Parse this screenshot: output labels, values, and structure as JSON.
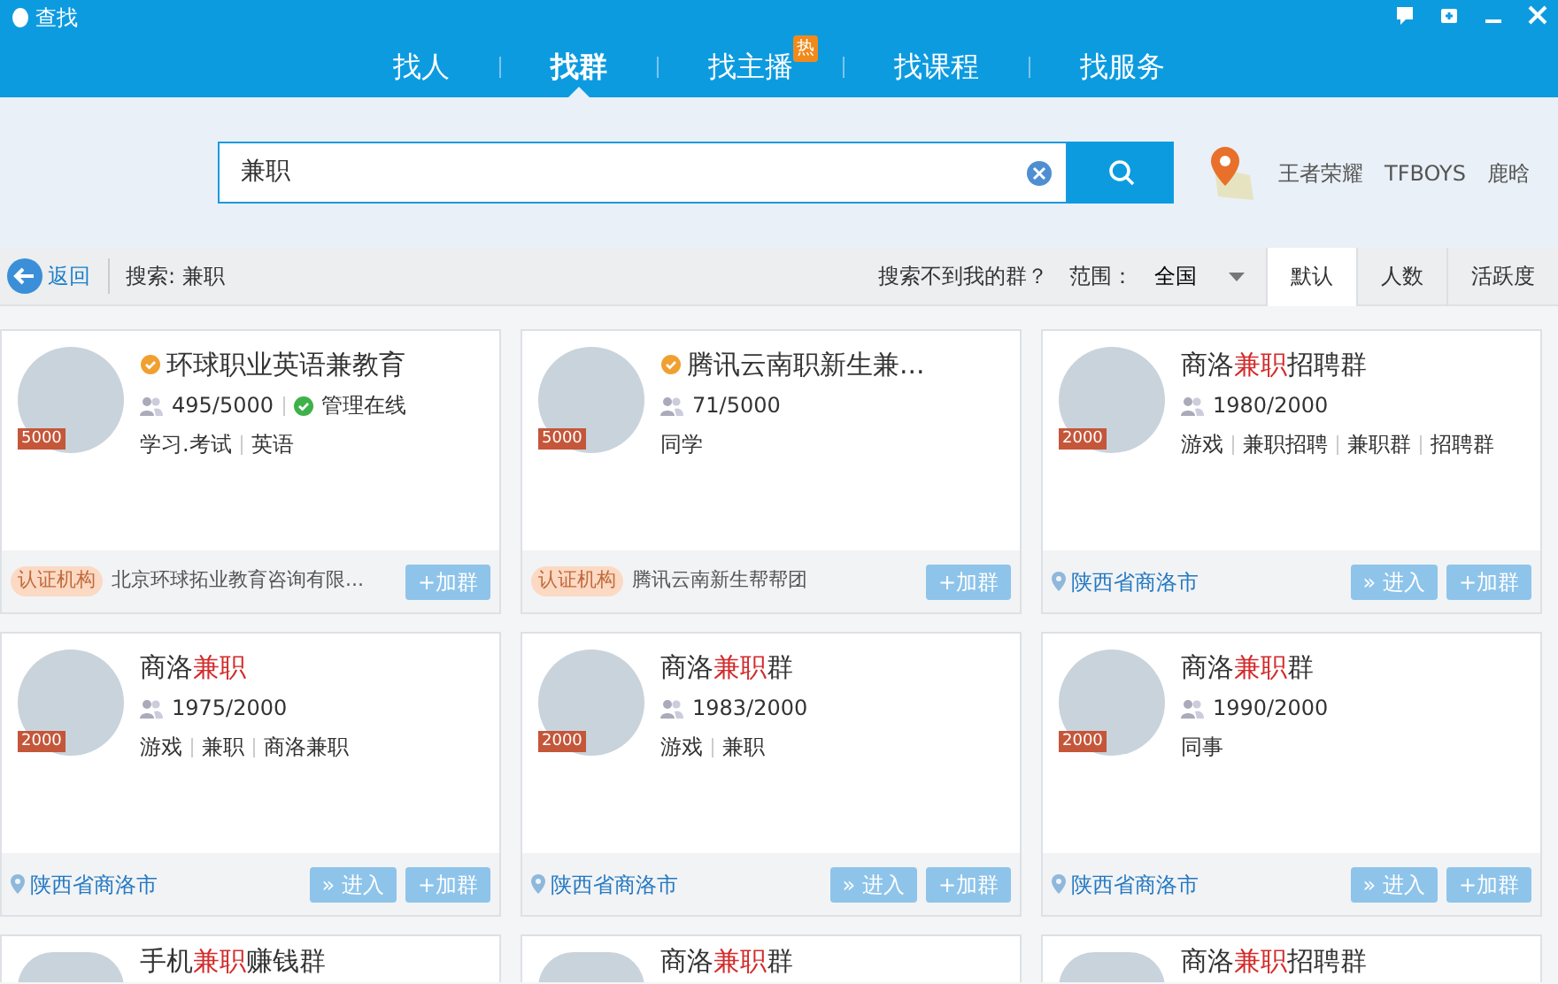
{
  "window": {
    "title": "查找"
  },
  "tabs": [
    {
      "label": "找人",
      "selected": false
    },
    {
      "label": "找群",
      "selected": true
    },
    {
      "label": "找主播",
      "selected": false,
      "badge": "热"
    },
    {
      "label": "找课程",
      "selected": false
    },
    {
      "label": "找服务",
      "selected": false
    }
  ],
  "search": {
    "value": "兼职",
    "hot_words": [
      "王者荣耀",
      "TFBOYS",
      "鹿晗"
    ]
  },
  "toolbar": {
    "back": "返回",
    "query": "搜索: 兼职",
    "help": "搜索不到我的群？",
    "range_label": "范围：",
    "range_value": "全国",
    "sorts": [
      {
        "label": "默认",
        "selected": true
      },
      {
        "label": "人数",
        "selected": false
      },
      {
        "label": "活跃度",
        "selected": false
      }
    ]
  },
  "groups": [
    {
      "name": [
        {
          "text": "环球职业英语兼教育",
          "highlight": false
        }
      ],
      "verified": true,
      "members": "495/5000",
      "admin_online": "管理在线",
      "tags": [
        "学习.考试",
        "英语"
      ],
      "capacity": "5000",
      "footer": {
        "kind": "org",
        "org_label": "认证机构",
        "org_name": "北京环球拓业教育咨询有限..."
      },
      "buttons": [
        "+加群"
      ]
    },
    {
      "name": [
        {
          "text": "腾讯云南职新生兼...",
          "highlight": false
        }
      ],
      "verified": true,
      "members": "71/5000",
      "tags": [
        "同学"
      ],
      "capacity": "5000",
      "footer": {
        "kind": "org",
        "org_label": "认证机构",
        "org_name": "腾讯云南新生帮帮团"
      },
      "buttons": [
        "+加群"
      ]
    },
    {
      "name": [
        {
          "text": "商洛",
          "highlight": false
        },
        {
          "text": "兼职",
          "highlight": true
        },
        {
          "text": "招聘群",
          "highlight": false
        }
      ],
      "verified": false,
      "members": "1980/2000",
      "tags": [
        "游戏",
        "兼职招聘",
        "兼职群",
        "招聘群"
      ],
      "capacity": "2000",
      "footer": {
        "kind": "location",
        "location": "陕西省商洛市"
      },
      "buttons": [
        "» 进入",
        "+加群"
      ]
    },
    {
      "name": [
        {
          "text": "商洛",
          "highlight": false
        },
        {
          "text": "兼职",
          "highlight": true
        }
      ],
      "verified": false,
      "members": "1975/2000",
      "tags": [
        "游戏",
        "兼职",
        "商洛兼职"
      ],
      "capacity": "2000",
      "footer": {
        "kind": "location",
        "location": "陕西省商洛市"
      },
      "buttons": [
        "» 进入",
        "+加群"
      ]
    },
    {
      "name": [
        {
          "text": "商洛",
          "highlight": false
        },
        {
          "text": "兼职",
          "highlight": true
        },
        {
          "text": "群",
          "highlight": false
        }
      ],
      "verified": false,
      "members": "1983/2000",
      "tags": [
        "游戏",
        "兼职"
      ],
      "capacity": "2000",
      "footer": {
        "kind": "location",
        "location": "陕西省商洛市"
      },
      "buttons": [
        "» 进入",
        "+加群"
      ]
    },
    {
      "name": [
        {
          "text": "商洛",
          "highlight": false
        },
        {
          "text": "兼职",
          "highlight": true
        },
        {
          "text": "群",
          "highlight": false
        }
      ],
      "verified": false,
      "members": "1990/2000",
      "tags": [
        "同事"
      ],
      "capacity": "2000",
      "footer": {
        "kind": "location",
        "location": "陕西省商洛市"
      },
      "buttons": [
        "» 进入",
        "+加群"
      ]
    },
    {
      "name": [
        {
          "text": "手机",
          "highlight": false
        },
        {
          "text": "兼职",
          "highlight": true
        },
        {
          "text": "赚钱群",
          "highlight": false
        }
      ]
    },
    {
      "name": [
        {
          "text": "商洛",
          "highlight": false
        },
        {
          "text": "兼职",
          "highlight": true
        },
        {
          "text": "群",
          "highlight": false
        }
      ]
    },
    {
      "name": [
        {
          "text": "商洛",
          "highlight": false
        },
        {
          "text": "兼职",
          "highlight": true
        },
        {
          "text": "招聘群",
          "highlight": false
        }
      ]
    }
  ]
}
